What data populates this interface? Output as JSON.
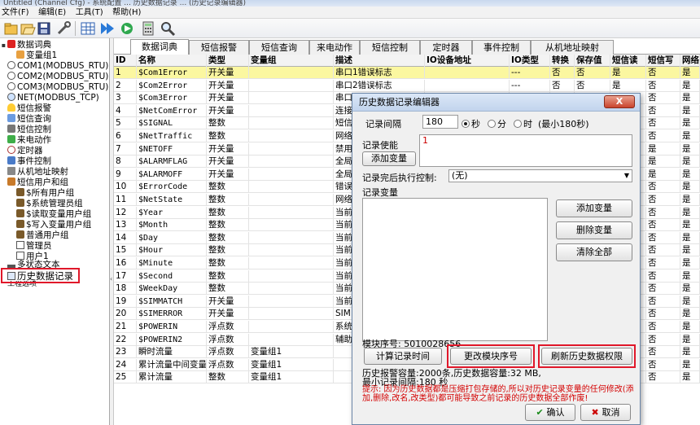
{
  "window": {
    "title": "Untitled (Channel Cfg) - 系统配置 ... 历史数据记录 ... (历史记录编辑器)"
  },
  "menu": [
    "文件(F)",
    "编辑(E)",
    "工具(T)",
    "帮助(H)"
  ],
  "toolbar_icons": [
    "open-folder-icon",
    "open-icon",
    "save-icon",
    "tools-icon",
    "grid-icon",
    "run-icon",
    "connect-icon",
    "calculator-icon",
    "search-icon"
  ],
  "tree": [
    {
      "label": "数据词典",
      "level": 0,
      "icon": "database-icon",
      "expander": "-"
    },
    {
      "label": "变量组1",
      "level": 1,
      "icon": "group-icon"
    },
    {
      "label": "COM1(MODBUS_RTU)",
      "level": 0,
      "icon": "port-icon",
      "expander": "-"
    },
    {
      "label": "COM2(MODBUS_RTU)",
      "level": 0,
      "icon": "port-icon"
    },
    {
      "label": "COM3(MODBUS_RTU)",
      "level": 0,
      "icon": "port-icon"
    },
    {
      "label": "NET(MODBUS_TCP)",
      "level": 0,
      "icon": "network-icon"
    },
    {
      "label": "短信报警",
      "level": 0,
      "icon": "alarm-icon",
      "expander": "-"
    },
    {
      "label": "短信查询",
      "level": 0,
      "icon": "query-icon"
    },
    {
      "label": "短信控制",
      "level": 0,
      "icon": "control-icon"
    },
    {
      "label": "来电动作",
      "level": 0,
      "icon": "phone-icon"
    },
    {
      "label": "定时器",
      "level": 0,
      "icon": "clock-icon"
    },
    {
      "label": "事件控制",
      "level": 0,
      "icon": "event-icon",
      "expander": "-"
    },
    {
      "label": "从机地址映射",
      "level": 0,
      "icon": "map-icon"
    },
    {
      "label": "短信用户和组",
      "level": 0,
      "icon": "users-icon",
      "expander": "-"
    },
    {
      "label": "$所有用户组",
      "level": 1,
      "icon": "user-group-icon"
    },
    {
      "label": "$系统管理员组",
      "level": 1,
      "icon": "user-group-icon"
    },
    {
      "label": "$读取变量用户组",
      "level": 1,
      "icon": "user-group-icon"
    },
    {
      "label": "$写入变量用户组",
      "level": 1,
      "icon": "user-group-icon"
    },
    {
      "label": "普通用户组",
      "level": 1,
      "icon": "user-group-icon"
    },
    {
      "label": "管理员",
      "level": 1,
      "icon": "user-icon"
    },
    {
      "label": "用户1",
      "level": 1,
      "icon": "user-icon"
    },
    {
      "label": "多状态文本",
      "level": 0,
      "icon": "text-icon"
    },
    {
      "label": "历史数据记录",
      "level": 0,
      "icon": "history-icon",
      "selected": true
    },
    {
      "label": "工程选项",
      "level": 0,
      "icon": "options-icon"
    }
  ],
  "tabs": [
    "数据词典",
    "短信报警",
    "短信查询",
    "来电动作",
    "短信控制",
    "定时器",
    "事件控制",
    "从机地址映射"
  ],
  "grid": {
    "columns": [
      "ID",
      "名称",
      "类型",
      "变量组",
      "描述",
      "IO设备地址",
      "IO类型",
      "转换",
      "保存值",
      "短信读",
      "短信写",
      "网络"
    ],
    "rows": [
      [
        "1",
        "$Com1Error",
        "开关量",
        "",
        "串口1错误标志",
        "",
        "---",
        "否",
        "否",
        "是",
        "否",
        "是"
      ],
      [
        "2",
        "$Com2Error",
        "开关量",
        "",
        "串口2错误标志",
        "",
        "---",
        "否",
        "否",
        "是",
        "否",
        "是"
      ],
      [
        "3",
        "$Com3Error",
        "开关量",
        "",
        "串口",
        "",
        "",
        "",
        "",
        "",
        "否",
        "是"
      ],
      [
        "4",
        "$NetComError",
        "开关量",
        "",
        "连接",
        "",
        "",
        "",
        "",
        "",
        "否",
        "是"
      ],
      [
        "5",
        "$SIGNAL",
        "整数",
        "",
        "短信",
        "",
        "",
        "",
        "",
        "",
        "否",
        "是"
      ],
      [
        "6",
        "$NetTraffic",
        "整数",
        "",
        "网络",
        "",
        "",
        "",
        "",
        "",
        "否",
        "是"
      ],
      [
        "7",
        "$NETOFF",
        "开关量",
        "",
        "禁用",
        "",
        "",
        "",
        "",
        "",
        "是",
        "是"
      ],
      [
        "8",
        "$ALARMFLAG",
        "开关量",
        "",
        "全局",
        "",
        "",
        "",
        "",
        "",
        "是",
        "是"
      ],
      [
        "9",
        "$ALARMOFF",
        "开关量",
        "",
        "全局",
        "",
        "",
        "",
        "",
        "",
        "是",
        "是"
      ],
      [
        "10",
        "$ErrorCode",
        "整数",
        "",
        "错误",
        "",
        "",
        "",
        "",
        "",
        "否",
        "是"
      ],
      [
        "11",
        "$NetState",
        "整数",
        "",
        "网络",
        "",
        "",
        "",
        "",
        "",
        "否",
        "是"
      ],
      [
        "12",
        "$Year",
        "整数",
        "",
        "当前",
        "",
        "",
        "",
        "",
        "",
        "否",
        "是"
      ],
      [
        "13",
        "$Month",
        "整数",
        "",
        "当前",
        "",
        "",
        "",
        "",
        "",
        "否",
        "是"
      ],
      [
        "14",
        "$Day",
        "整数",
        "",
        "当前",
        "",
        "",
        "",
        "",
        "",
        "否",
        "是"
      ],
      [
        "15",
        "$Hour",
        "整数",
        "",
        "当前",
        "",
        "",
        "",
        "",
        "",
        "否",
        "是"
      ],
      [
        "16",
        "$Minute",
        "整数",
        "",
        "当前",
        "",
        "",
        "",
        "",
        "",
        "否",
        "是"
      ],
      [
        "17",
        "$Second",
        "整数",
        "",
        "当前",
        "",
        "",
        "",
        "",
        "",
        "否",
        "是"
      ],
      [
        "18",
        "$WeekDay",
        "整数",
        "",
        "当前",
        "",
        "",
        "",
        "",
        "",
        "否",
        "是"
      ],
      [
        "19",
        "$SIMMATCH",
        "开关量",
        "",
        "当前",
        "",
        "",
        "",
        "",
        "",
        "否",
        "是"
      ],
      [
        "20",
        "$SIMERROR",
        "开关量",
        "",
        "SIM",
        "",
        "",
        "",
        "",
        "",
        "否",
        "是"
      ],
      [
        "21",
        "$POWERIN",
        "浮点数",
        "",
        "系统",
        "",
        "",
        "",
        "",
        "",
        "否",
        "是"
      ],
      [
        "22",
        "$POWERIN2",
        "浮点数",
        "",
        "辅助",
        "",
        "",
        "",
        "",
        "",
        "否",
        "是"
      ],
      [
        "23",
        "瞬时流量",
        "浮点数",
        "变量组1",
        "",
        "",
        "",
        "",
        "",
        "",
        "否",
        "是"
      ],
      [
        "24",
        "累计流量中间变量",
        "浮点数",
        "变量组1",
        "",
        "",
        "",
        "",
        "",
        "",
        "否",
        "是"
      ],
      [
        "25",
        "累计流量",
        "整数",
        "变量组1",
        "",
        "",
        "",
        "",
        "",
        "",
        "否",
        "是"
      ]
    ]
  },
  "dialog": {
    "title": "历史数据记录编辑器",
    "close_label": "X",
    "interval_label": "记录间隔",
    "interval_value": "180",
    "unit_sec": "秒",
    "unit_min": "分",
    "unit_hour": "时",
    "min_note": "(最小180秒)",
    "enable_label": "记录使能",
    "enable_value": "1",
    "add_var_small": "添加变量",
    "after_label": "记录完后执行控制:",
    "after_value": "(无)",
    "vars_label": "记录变量",
    "add_var": "添加变量",
    "del_var": "删除变量",
    "clear_all": "清除全部",
    "block_no": "模块序号: 5010028656",
    "calc_time": "计算记录时间",
    "change_block": "更改模块序号",
    "refresh_perm": "刷新历史数据权限",
    "capacity": "历史报警容量:2000条,历史数据容量:32 MB,",
    "min_interval": "最小记录间隔:180 秒",
    "warning": "提示: 因为历史数据都是压缩打包存储的,所以对历史记录变量的任何修改(添加,删除,改名,改类型)都可能导致之前记录的历史数据全部作废!",
    "ok": "确认",
    "cancel": "取消"
  },
  "colors": {
    "highlight": "#e0182a",
    "warning_text": "#d40000",
    "selected_row": "#fbf7a0"
  }
}
